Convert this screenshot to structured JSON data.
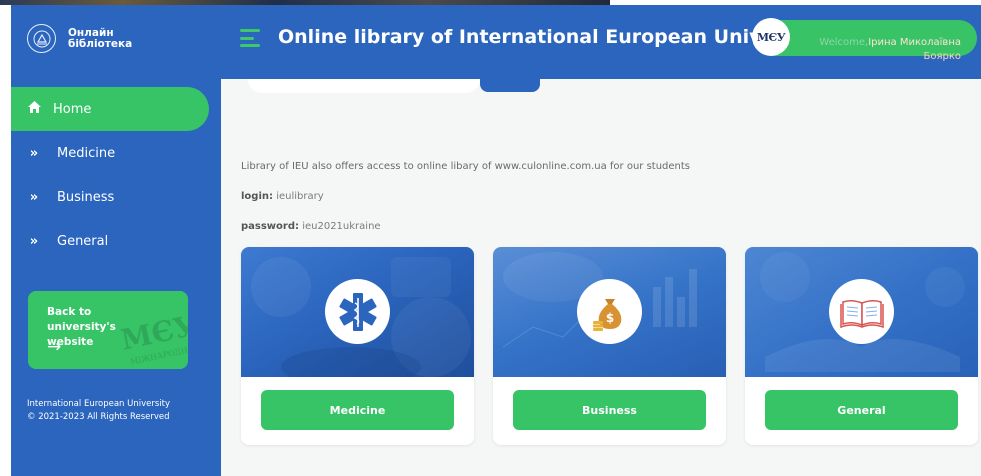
{
  "logo": {
    "line1": "Онлайн",
    "line2": "бібліотека"
  },
  "header": {
    "title": "Online library of International European University",
    "avatar_text": "МЄУ",
    "welcome_static": "Welcome,",
    "user_first": "Ірина Миколаївна",
    "user_last": "Боярко"
  },
  "sidebar": {
    "items": [
      {
        "label": "Home",
        "icon": "home-icon",
        "active": true
      },
      {
        "label": "Medicine",
        "icon": "double-chevron-right-icon"
      },
      {
        "label": "Business",
        "icon": "double-chevron-right-icon"
      },
      {
        "label": "General",
        "icon": "double-chevron-right-icon"
      }
    ],
    "back_card": {
      "label": "Back to university's website",
      "arrow": "→"
    },
    "footer": {
      "org": "International European University",
      "copyright": "© 2021-2023 All Rights Reserved"
    }
  },
  "main": {
    "info": "Library of IEU also offers access to online libary of www.culonline.com.ua for our students",
    "login_label": "login:",
    "login_value": "ieulibrary",
    "password_label": "password:",
    "password_value": "ieu2021ukraine",
    "cards": [
      {
        "label": "Medicine",
        "icon": "star-of-life-icon"
      },
      {
        "label": "Business",
        "icon": "money-bag-icon"
      },
      {
        "label": "General",
        "icon": "open-book-icon"
      }
    ]
  },
  "colors": {
    "primary_blue": "#2b65be",
    "accent_green": "#36c466",
    "background": "#f4f7f6"
  }
}
